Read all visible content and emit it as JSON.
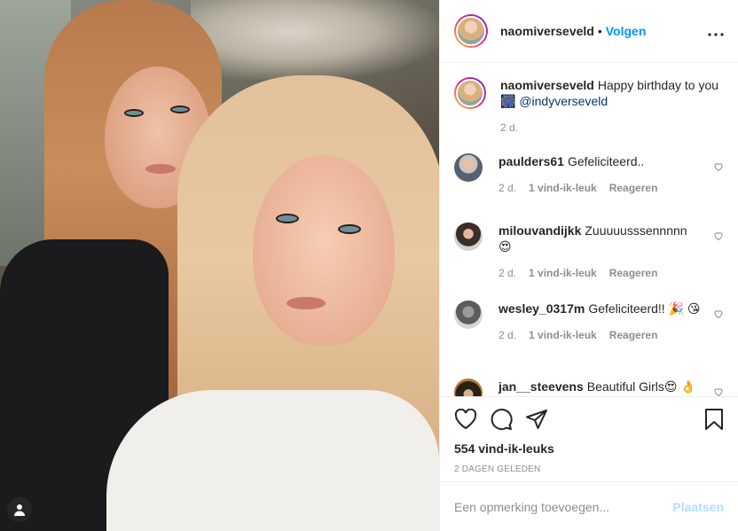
{
  "header": {
    "username": "naomiverseveld",
    "separator": "•",
    "follow_label": "Volgen",
    "more_label": "•••"
  },
  "caption": {
    "username": "naomiverseveld",
    "text": "Happy birthday to you",
    "emoji": "🎆",
    "mention": "@indyverseveld",
    "time": "2 d."
  },
  "comments": [
    {
      "username": "paulders61",
      "text": "Gefeliciteerd..",
      "time": "2 d.",
      "likes": "1 vind-ik-leuk",
      "reply": "Reageren"
    },
    {
      "username": "milouvandijkk",
      "text": "Zuuuuusssennnnn 😍",
      "time": "2 d.",
      "likes": "1 vind-ik-leuk",
      "reply": "Reageren"
    },
    {
      "username": "wesley_0317m",
      "text": "Gefeliciteerd!! 🎉 😘",
      "time": "2 d.",
      "likes": "1 vind-ik-leuk",
      "reply": "Reageren"
    },
    {
      "username": "jan__steevens",
      "text": "Beautiful Girls😍 👌",
      "time": "",
      "likes": "",
      "reply": ""
    }
  ],
  "actions": {
    "likes": "554 vind-ik-leuks",
    "date": "2 DAGEN GELEDEN"
  },
  "add_comment": {
    "placeholder": "Een opmerking toevoegen...",
    "post_label": "Plaatsen"
  },
  "colors": {
    "accent": "#0095f6",
    "post_disabled": "#b2dffc",
    "muted": "#8e8e8e",
    "text": "#262626"
  },
  "icons": [
    "user-tag-icon",
    "heart-icon",
    "comment-icon",
    "share-icon",
    "bookmark-icon",
    "more-icon"
  ]
}
